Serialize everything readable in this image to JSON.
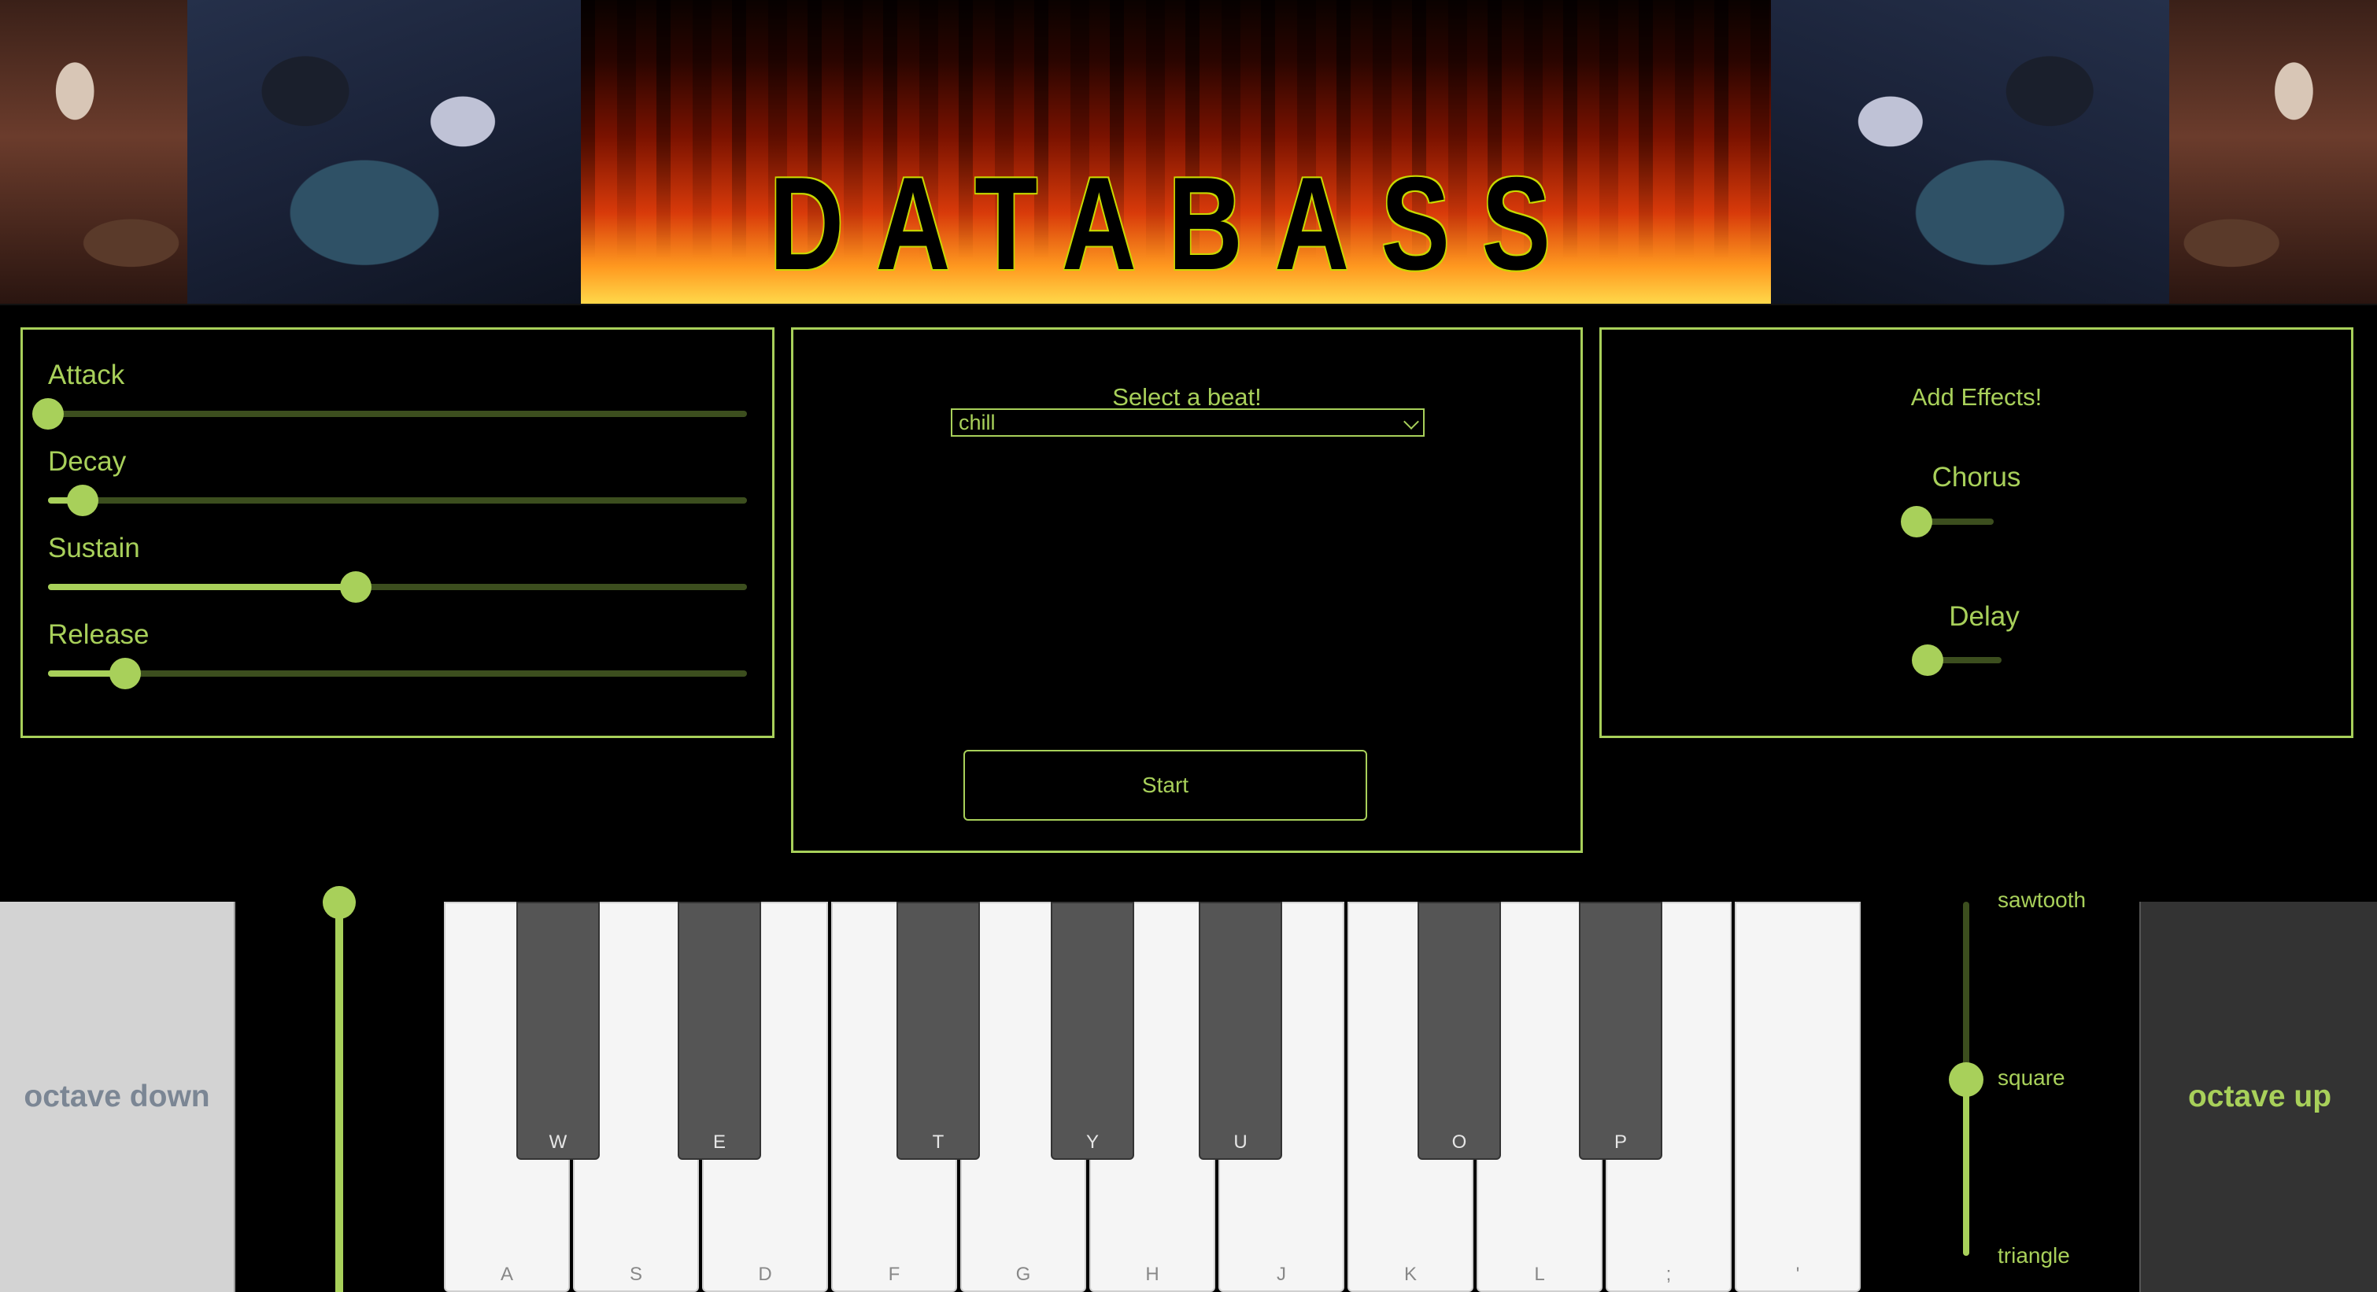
{
  "banner": {
    "logo_text": "DATABASS"
  },
  "envelope": {
    "controls": [
      {
        "label": "Attack",
        "value": 0.0
      },
      {
        "label": "Decay",
        "value": 0.05
      },
      {
        "label": "Sustain",
        "value": 0.44
      },
      {
        "label": "Release",
        "value": 0.11
      }
    ]
  },
  "beat": {
    "title": "Select a beat!",
    "selected": "chill",
    "start_label": "Start"
  },
  "effects": {
    "title": "Add Effects!",
    "chorus_label": "Chorus",
    "chorus_value": 0.0,
    "delay_label": "Delay",
    "delay_value": 0.0
  },
  "keyboard": {
    "octave_down_label": "octave down",
    "octave_up_label": "octave up",
    "volume_value": 1.0,
    "white_keys": [
      "A",
      "S",
      "D",
      "F",
      "G",
      "H",
      "J",
      "K",
      "L",
      ";",
      "'"
    ],
    "black_keys": [
      "W",
      "E",
      "T",
      "Y",
      "U",
      "O",
      "P"
    ],
    "waveform": {
      "options": [
        "sawtooth",
        "square",
        "triangle"
      ],
      "selected": "square"
    }
  },
  "colors": {
    "accent": "#a8d05a",
    "background": "#000000",
    "track_dark": "#3c4e1e"
  }
}
